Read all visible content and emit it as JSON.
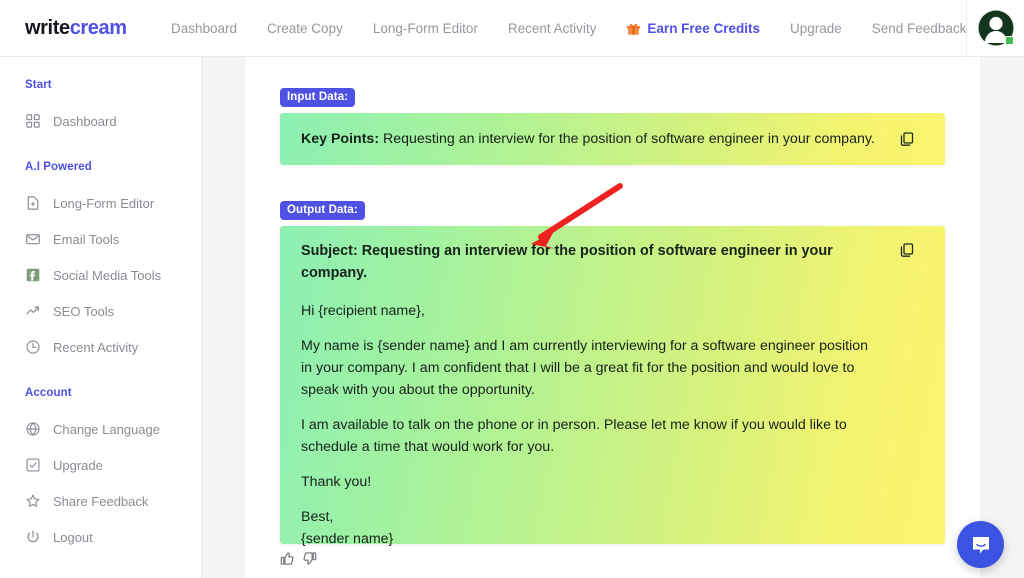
{
  "brand": {
    "part1": "write",
    "part2": "cream"
  },
  "topnav": {
    "links": [
      {
        "label": "Dashboard",
        "accent": false
      },
      {
        "label": "Create Copy",
        "accent": false
      },
      {
        "label": "Long-Form Editor",
        "accent": false
      },
      {
        "label": "Recent Activity",
        "accent": false
      },
      {
        "label": "Earn Free Credits",
        "accent": true,
        "icon": "gift-icon"
      },
      {
        "label": "Upgrade",
        "accent": false
      },
      {
        "label": "Send Feedback",
        "accent": false
      }
    ],
    "avatar_icon": "user-avatar-icon"
  },
  "sidebar": {
    "section_start": "Start",
    "section_ai": "A.I Powered",
    "section_account": "Account",
    "start_items": [
      {
        "label": "Dashboard",
        "icon": "grid-icon"
      }
    ],
    "ai_items": [
      {
        "label": "Long-Form Editor",
        "icon": "document-add-icon"
      },
      {
        "label": "Email Tools",
        "icon": "envelope-icon"
      },
      {
        "label": "Social Media Tools",
        "icon": "facebook-square-icon"
      },
      {
        "label": "SEO Tools",
        "icon": "trending-up-icon"
      },
      {
        "label": "Recent Activity",
        "icon": "clock-icon"
      }
    ],
    "account_items": [
      {
        "label": "Change Language",
        "icon": "globe-icon"
      },
      {
        "label": "Upgrade",
        "icon": "checkbox-square-icon"
      },
      {
        "label": "Share Feedback",
        "icon": "star-icon"
      },
      {
        "label": "Logout",
        "icon": "power-icon"
      }
    ]
  },
  "main": {
    "input_badge": "Input Data:",
    "output_badge": "Output Data:",
    "input": {
      "key_label": "Key Points:",
      "key_value": " Requesting an interview for the position of software engineer in your company.",
      "copy_icon": "copy-icon"
    },
    "output": {
      "copy_icon": "copy-icon",
      "subject": "Subject: Requesting an interview for the position of software engineer in your company.",
      "paragraphs": [
        "Hi {recipient name},",
        "My name is {sender name} and I am currently interviewing for a software engineer position in your company. I am confident that I will be a great fit for the position and would love to speak with you about the opportunity.",
        "I am available to talk on the phone or in person. Please let me know if you would like to schedule a time that would work for you.",
        "Thank you!"
      ],
      "signoff_line1": "Best,",
      "signoff_line2": "{sender name}"
    },
    "feedback": {
      "thumbs_up_icon": "thumbs-up-icon",
      "thumbs_down_icon": "thumbs-down-icon"
    },
    "annotation_arrow": "red-arrow-annotation"
  },
  "chat": {
    "icon": "chat-bubble-icon"
  },
  "colors": {
    "accent_blue": "#4e51e4",
    "gradient_start": "#8cf0b4",
    "gradient_end": "#f8f46e",
    "arrow_red": "#ef2222",
    "chat_blue": "#3b53e0"
  }
}
